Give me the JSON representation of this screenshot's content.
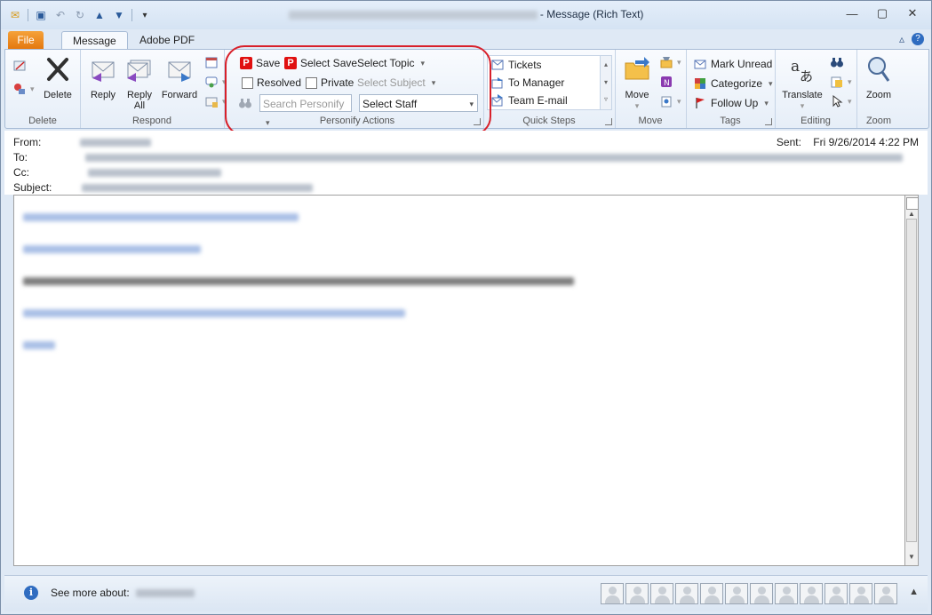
{
  "window": {
    "title_suffix": " - Message (Rich Text)",
    "controls": {
      "minimize": "—",
      "maximize": "▢",
      "close": "✕"
    }
  },
  "tabs": {
    "file": "File",
    "message": "Message",
    "pdf": "Adobe PDF"
  },
  "ribbon": {
    "delete": {
      "label": "Delete",
      "delete_btn": "Delete"
    },
    "respond": {
      "label": "Respond",
      "reply": "Reply",
      "reply_all_1": "Reply",
      "reply_all_2": "All",
      "forward": "Forward"
    },
    "personify": {
      "label": "Personify Actions",
      "save": "Save",
      "select_save": "Select Save",
      "select_topic": "Select Topic",
      "resolved": "Resolved",
      "private": "Private",
      "select_subject": "Select Subject",
      "search_personify": "Search Personify",
      "select_staff": "Select Staff"
    },
    "quicksteps": {
      "label": "Quick Steps",
      "items": [
        "Tickets",
        "To Manager",
        "Team E-mail"
      ]
    },
    "move": {
      "label": "Move",
      "move_btn": "Move"
    },
    "tags": {
      "label": "Tags",
      "mark_unread": "Mark Unread",
      "categorize": "Categorize",
      "follow_up": "Follow Up"
    },
    "editing": {
      "label": "Editing",
      "translate": "Translate"
    },
    "zoom": {
      "label": "Zoom",
      "zoom_btn": "Zoom"
    }
  },
  "header": {
    "from_label": "From:",
    "to_label": "To:",
    "cc_label": "Cc:",
    "subject_label": "Subject:",
    "sent_label": "Sent:",
    "sent_value": "Fri 9/26/2014 4:22 PM"
  },
  "people_pane": {
    "see_more": "See more about:"
  },
  "colors": {
    "accent": "#2f6cc0",
    "file_tab": "#e4780f",
    "highlight": "#d8202a"
  }
}
